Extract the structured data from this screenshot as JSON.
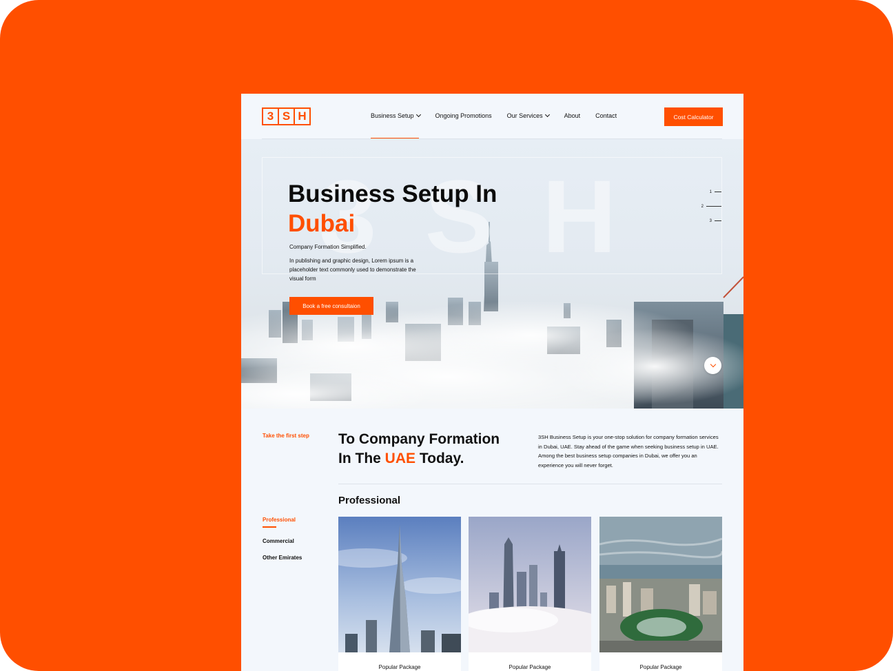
{
  "brand": {
    "logo_letters": [
      "3",
      "S",
      "H"
    ]
  },
  "nav": {
    "items": [
      {
        "label": "Business Setup",
        "dropdown": true
      },
      {
        "label": "Ongoing Promotions",
        "dropdown": false
      },
      {
        "label": "Our Services",
        "dropdown": true
      },
      {
        "label": "About",
        "dropdown": false
      },
      {
        "label": "Contact",
        "dropdown": false
      }
    ],
    "cta_label": "Cost Calculator"
  },
  "hero": {
    "watermark": "3SH",
    "title_line1": "Business Setup In",
    "title_line2": "Dubai",
    "subtitle": "Company Formation Simplified.",
    "description": "In publishing and graphic design, Lorem ipsum is a placeholder text commonly used to demonstrate the visual form",
    "button_label": "Book a free consultaion",
    "slides": [
      "1",
      "2",
      "3"
    ]
  },
  "intro": {
    "kicker": "Take the first step",
    "title_part1": "To Company Formation",
    "title_part2": "In The ",
    "title_accent": "UAE",
    "title_part3": " Today.",
    "description": "3SH Business Setup is your one-stop solution for company formation services in Dubai, UAE. Stay ahead of the game when seeking business setup in UAE. Among the best business setup companies in Dubai, we offer you an experience you will never forget."
  },
  "packages": {
    "heading": "Professional",
    "tabs": [
      "Professional",
      "Commercial",
      "Other Emirates"
    ],
    "cards": [
      {
        "caption": "Popular Package"
      },
      {
        "caption": "Popular Package"
      },
      {
        "caption": "Popular Package"
      }
    ]
  },
  "colors": {
    "accent": "#ff4f00",
    "page_bg": "#f3f7fc",
    "text": "#111111"
  }
}
